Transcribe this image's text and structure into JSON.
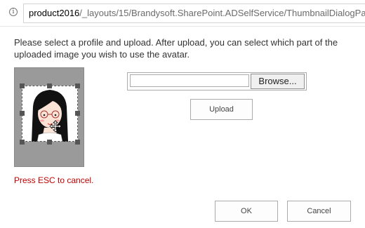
{
  "address_bar": {
    "info_icon": "info-icon",
    "host": "product2016",
    "path": "/_layouts/15/Brandysoft.SharePoint.ADSelfService/ThumbnailDialogPa"
  },
  "dialog": {
    "instructions": "Please select a profile and upload. After upload, you can select which part of the uploaded image you wish to use the avatar.",
    "file_input": {
      "value": "",
      "browse_label": "Browse..."
    },
    "upload_label": "Upload",
    "escape_hint": "Press ESC to cancel.",
    "ok_label": "OK",
    "cancel_label": "Cancel"
  },
  "colors": {
    "escape_hint": "#c00000",
    "preview_background": "#9a9a9a"
  }
}
